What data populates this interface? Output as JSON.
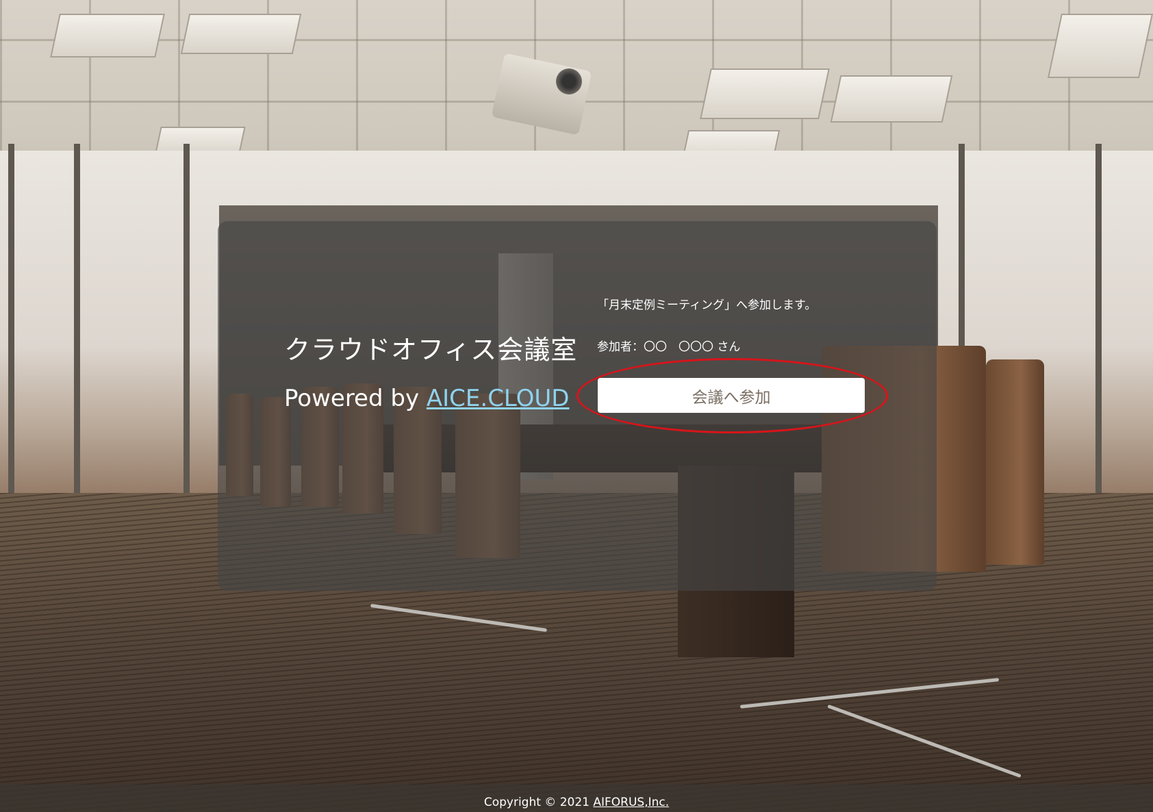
{
  "brand": {
    "title": "クラウドオフィス会議室",
    "powered_prefix": "Powered by ",
    "powered_link": "AICE.CLOUD"
  },
  "meeting": {
    "join_message": "「月末定例ミーティング」へ参加します。",
    "participant": "参加者：〇〇　〇〇〇 さん",
    "join_button_label": "会議へ参加"
  },
  "footer": {
    "copyright_prefix": "Copyright © 2021 ",
    "company_link": "AIFORUS,Inc."
  },
  "colors": {
    "link": "#8fd3ee",
    "highlight": "#d8141a",
    "button_text": "#7a6f63"
  }
}
